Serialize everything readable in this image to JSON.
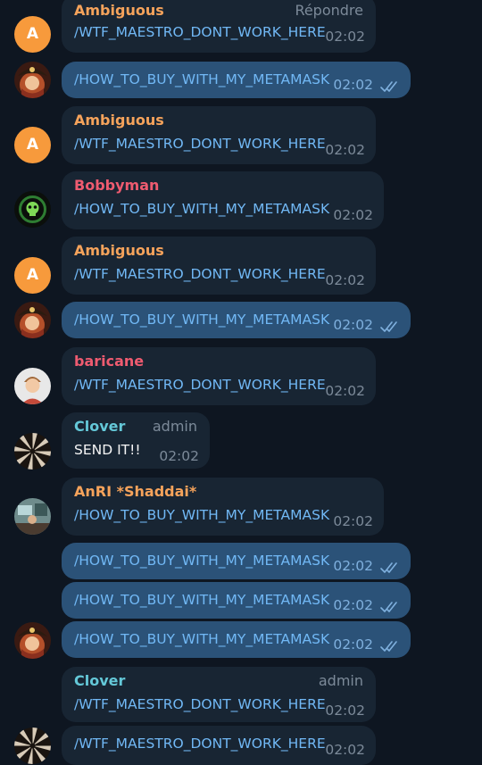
{
  "colors": {
    "background": "#0e1621",
    "bubble_in": "#182533",
    "bubble_out": "#2b5278",
    "command_link": "#71b8f5",
    "name_orange": "#f6a35b",
    "name_red": "#ef5b70",
    "name_teal": "#64c8d8",
    "meta_gray": "#7c8a99",
    "read_ticks": "#7fb0de"
  },
  "messages": [
    {
      "sender": "Ambiguous",
      "tag": "Répondre",
      "text": "/WTF_MAESTRO_DONT_WORK_HERE",
      "time": "02:02"
    },
    {
      "text": "/HOW_TO_BUY_WITH_MY_METAMASK",
      "time": "02:02",
      "status": "read-double-check-icon"
    },
    {
      "sender": "Ambiguous",
      "text": "/WTF_MAESTRO_DONT_WORK_HERE",
      "time": "02:02"
    },
    {
      "sender": "Bobbyman",
      "text": "/HOW_TO_BUY_WITH_MY_METAMASK",
      "time": "02:02"
    },
    {
      "sender": "Ambiguous",
      "text": "/WTF_MAESTRO_DONT_WORK_HERE",
      "time": "02:02"
    },
    {
      "text": "/HOW_TO_BUY_WITH_MY_METAMASK",
      "time": "02:02",
      "status": "read-double-check-icon"
    },
    {
      "sender": "baricane",
      "text": "/WTF_MAESTRO_DONT_WORK_HERE",
      "time": "02:02"
    },
    {
      "sender": "Clover",
      "tag": "admin",
      "text": "SEND IT!!",
      "time": "02:02"
    },
    {
      "sender": "AnRI *Shaddai*",
      "text": "/HOW_TO_BUY_WITH_MY_METAMASK",
      "time": "02:02"
    },
    {
      "text": "/HOW_TO_BUY_WITH_MY_METAMASK",
      "time": "02:02",
      "status": "read-double-check-icon"
    },
    {
      "text": "/HOW_TO_BUY_WITH_MY_METAMASK",
      "time": "02:02",
      "status": "read-double-check-icon"
    },
    {
      "text": "/HOW_TO_BUY_WITH_MY_METAMASK",
      "time": "02:02",
      "status": "read-double-check-icon"
    },
    {
      "sender": "Clover",
      "tag": "admin",
      "text": "/WTF_MAESTRO_DONT_WORK_HERE",
      "time": "02:02"
    },
    {
      "text": "/WTF_MAESTRO_DONT_WORK_HERE",
      "time": "02:02"
    }
  ],
  "avatars": [
    {
      "letter": "A",
      "icon": "letter-avatar"
    },
    {
      "icon": "pirate-girl-avatar"
    },
    {
      "letter": "A",
      "icon": "letter-avatar"
    },
    {
      "icon": "green-skull-avatar"
    },
    {
      "letter": "A",
      "icon": "letter-avatar"
    },
    {
      "icon": "pirate-girl-avatar"
    },
    {
      "icon": "boy-photo-avatar"
    },
    {
      "icon": "spiral-avatar"
    },
    {
      "icon": "room-photo-avatar"
    },
    {
      "icon": "pirate-girl-avatar"
    },
    {
      "icon": "spiral-avatar"
    }
  ]
}
